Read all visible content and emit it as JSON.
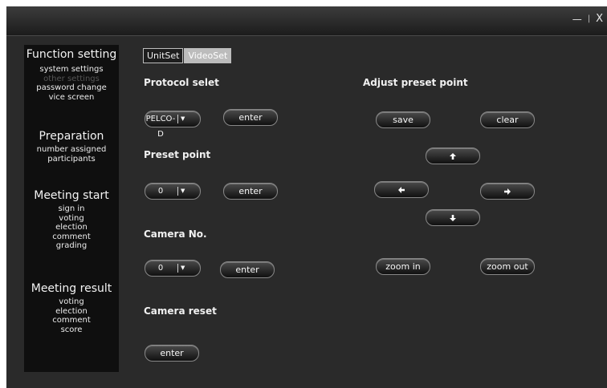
{
  "window": {
    "minimize": "—",
    "separator": "|",
    "close": "X"
  },
  "sidebar": {
    "function_setting": {
      "title": "Function setting",
      "items": [
        "system settings",
        "other settings",
        "password change",
        "vice screen"
      ]
    },
    "preparation": {
      "title": "Preparation",
      "items": [
        "number assigned",
        "participants"
      ]
    },
    "meeting_start": {
      "title": "Meeting start",
      "items": [
        "sign in",
        "voting",
        "election",
        "comment",
        "grading"
      ]
    },
    "meeting_result": {
      "title": "Meeting result",
      "items": [
        "voting",
        "election",
        "comment",
        "score"
      ]
    }
  },
  "tabs": {
    "unitset": "UnitSet",
    "videoset": "VideoSet"
  },
  "protocol": {
    "label": "Protocol selet",
    "value": "PELCO-D",
    "enter": "enter"
  },
  "preset": {
    "label": "Preset point",
    "value": "0",
    "enter": "enter"
  },
  "camera_no": {
    "label": "Camera No.",
    "value": "0",
    "enter": "enter"
  },
  "camera_reset": {
    "label": "Camera reset",
    "enter": "enter"
  },
  "adjust": {
    "label": "Adjust preset point",
    "save": "save",
    "clear": "clear",
    "zoom_in": "zoom in",
    "zoom_out": "zoom out"
  },
  "icons": {
    "up": "arrow-up-icon",
    "down": "arrow-down-icon",
    "left": "arrow-left-icon",
    "right": "arrow-right-icon",
    "dropdown": "dropdown-arrow-icon"
  }
}
